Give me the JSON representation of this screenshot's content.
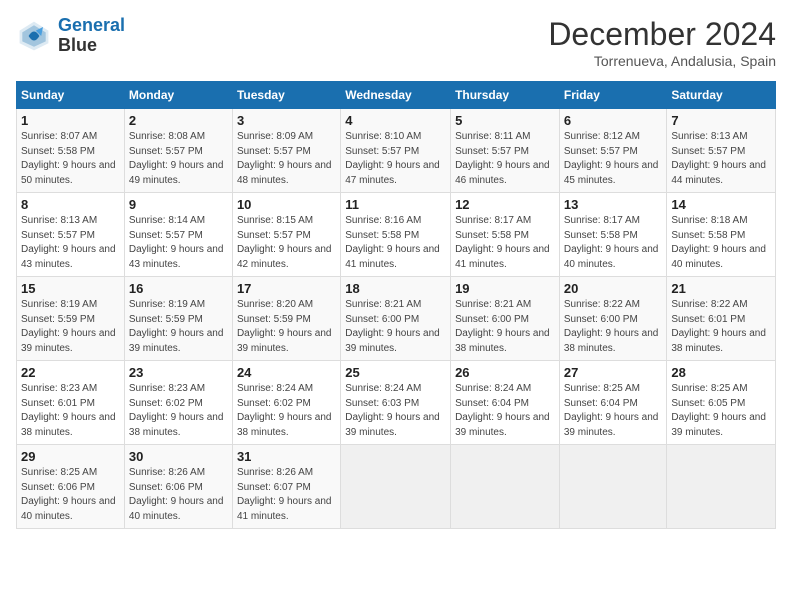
{
  "header": {
    "logo_line1": "General",
    "logo_line2": "Blue",
    "month_title": "December 2024",
    "subtitle": "Torrenueva, Andalusia, Spain"
  },
  "days_of_week": [
    "Sunday",
    "Monday",
    "Tuesday",
    "Wednesday",
    "Thursday",
    "Friday",
    "Saturday"
  ],
  "weeks": [
    [
      {
        "day": "1",
        "info": "Sunrise: 8:07 AM\nSunset: 5:58 PM\nDaylight: 9 hours and 50 minutes."
      },
      {
        "day": "2",
        "info": "Sunrise: 8:08 AM\nSunset: 5:57 PM\nDaylight: 9 hours and 49 minutes."
      },
      {
        "day": "3",
        "info": "Sunrise: 8:09 AM\nSunset: 5:57 PM\nDaylight: 9 hours and 48 minutes."
      },
      {
        "day": "4",
        "info": "Sunrise: 8:10 AM\nSunset: 5:57 PM\nDaylight: 9 hours and 47 minutes."
      },
      {
        "day": "5",
        "info": "Sunrise: 8:11 AM\nSunset: 5:57 PM\nDaylight: 9 hours and 46 minutes."
      },
      {
        "day": "6",
        "info": "Sunrise: 8:12 AM\nSunset: 5:57 PM\nDaylight: 9 hours and 45 minutes."
      },
      {
        "day": "7",
        "info": "Sunrise: 8:13 AM\nSunset: 5:57 PM\nDaylight: 9 hours and 44 minutes."
      }
    ],
    [
      {
        "day": "8",
        "info": "Sunrise: 8:13 AM\nSunset: 5:57 PM\nDaylight: 9 hours and 43 minutes."
      },
      {
        "day": "9",
        "info": "Sunrise: 8:14 AM\nSunset: 5:57 PM\nDaylight: 9 hours and 43 minutes."
      },
      {
        "day": "10",
        "info": "Sunrise: 8:15 AM\nSunset: 5:57 PM\nDaylight: 9 hours and 42 minutes."
      },
      {
        "day": "11",
        "info": "Sunrise: 8:16 AM\nSunset: 5:58 PM\nDaylight: 9 hours and 41 minutes."
      },
      {
        "day": "12",
        "info": "Sunrise: 8:17 AM\nSunset: 5:58 PM\nDaylight: 9 hours and 41 minutes."
      },
      {
        "day": "13",
        "info": "Sunrise: 8:17 AM\nSunset: 5:58 PM\nDaylight: 9 hours and 40 minutes."
      },
      {
        "day": "14",
        "info": "Sunrise: 8:18 AM\nSunset: 5:58 PM\nDaylight: 9 hours and 40 minutes."
      }
    ],
    [
      {
        "day": "15",
        "info": "Sunrise: 8:19 AM\nSunset: 5:59 PM\nDaylight: 9 hours and 39 minutes."
      },
      {
        "day": "16",
        "info": "Sunrise: 8:19 AM\nSunset: 5:59 PM\nDaylight: 9 hours and 39 minutes."
      },
      {
        "day": "17",
        "info": "Sunrise: 8:20 AM\nSunset: 5:59 PM\nDaylight: 9 hours and 39 minutes."
      },
      {
        "day": "18",
        "info": "Sunrise: 8:21 AM\nSunset: 6:00 PM\nDaylight: 9 hours and 39 minutes."
      },
      {
        "day": "19",
        "info": "Sunrise: 8:21 AM\nSunset: 6:00 PM\nDaylight: 9 hours and 38 minutes."
      },
      {
        "day": "20",
        "info": "Sunrise: 8:22 AM\nSunset: 6:00 PM\nDaylight: 9 hours and 38 minutes."
      },
      {
        "day": "21",
        "info": "Sunrise: 8:22 AM\nSunset: 6:01 PM\nDaylight: 9 hours and 38 minutes."
      }
    ],
    [
      {
        "day": "22",
        "info": "Sunrise: 8:23 AM\nSunset: 6:01 PM\nDaylight: 9 hours and 38 minutes."
      },
      {
        "day": "23",
        "info": "Sunrise: 8:23 AM\nSunset: 6:02 PM\nDaylight: 9 hours and 38 minutes."
      },
      {
        "day": "24",
        "info": "Sunrise: 8:24 AM\nSunset: 6:02 PM\nDaylight: 9 hours and 38 minutes."
      },
      {
        "day": "25",
        "info": "Sunrise: 8:24 AM\nSunset: 6:03 PM\nDaylight: 9 hours and 39 minutes."
      },
      {
        "day": "26",
        "info": "Sunrise: 8:24 AM\nSunset: 6:04 PM\nDaylight: 9 hours and 39 minutes."
      },
      {
        "day": "27",
        "info": "Sunrise: 8:25 AM\nSunset: 6:04 PM\nDaylight: 9 hours and 39 minutes."
      },
      {
        "day": "28",
        "info": "Sunrise: 8:25 AM\nSunset: 6:05 PM\nDaylight: 9 hours and 39 minutes."
      }
    ],
    [
      {
        "day": "29",
        "info": "Sunrise: 8:25 AM\nSunset: 6:06 PM\nDaylight: 9 hours and 40 minutes."
      },
      {
        "day": "30",
        "info": "Sunrise: 8:26 AM\nSunset: 6:06 PM\nDaylight: 9 hours and 40 minutes."
      },
      {
        "day": "31",
        "info": "Sunrise: 8:26 AM\nSunset: 6:07 PM\nDaylight: 9 hours and 41 minutes."
      },
      {
        "day": "",
        "info": ""
      },
      {
        "day": "",
        "info": ""
      },
      {
        "day": "",
        "info": ""
      },
      {
        "day": "",
        "info": ""
      }
    ]
  ]
}
